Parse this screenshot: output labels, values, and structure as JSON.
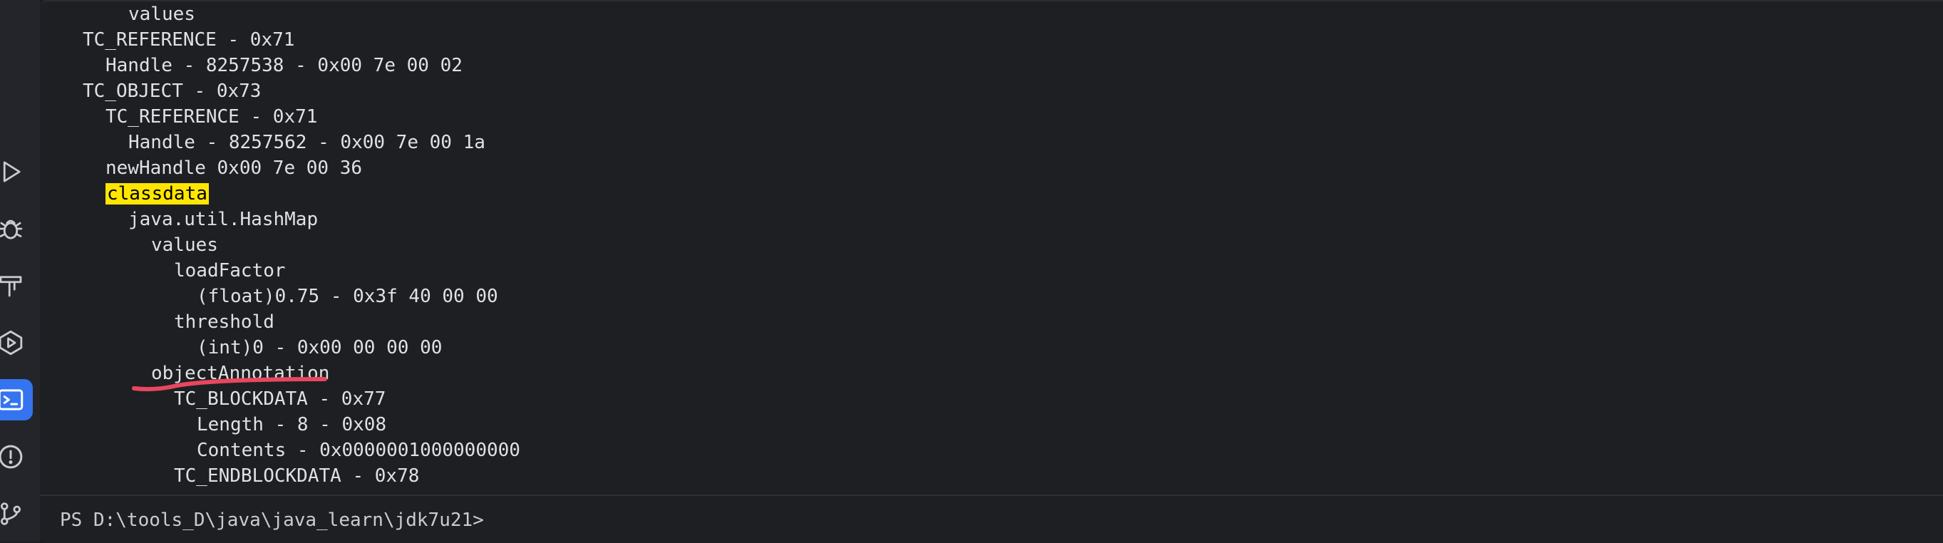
{
  "sidebar": {
    "icons": [
      {
        "name": "run-icon",
        "active": false
      },
      {
        "name": "debug-icon",
        "active": false
      },
      {
        "name": "build-icon",
        "active": false
      },
      {
        "name": "services-icon",
        "active": false
      },
      {
        "name": "terminal-icon",
        "active": true
      },
      {
        "name": "problems-icon",
        "active": false
      },
      {
        "name": "git-icon",
        "active": false
      }
    ]
  },
  "terminal": {
    "lines": [
      {
        "indent": 3,
        "text": "values"
      },
      {
        "indent": 1,
        "text": "TC_REFERENCE - 0x71"
      },
      {
        "indent": 2,
        "text": "Handle - 8257538 - 0x00 7e 00 02"
      },
      {
        "indent": 1,
        "text": "TC_OBJECT - 0x73"
      },
      {
        "indent": 2,
        "text": "TC_REFERENCE - 0x71"
      },
      {
        "indent": 3,
        "text": "Handle - 8257562 - 0x00 7e 00 1a"
      },
      {
        "indent": 2,
        "text": "newHandle 0x00 7e 00 36"
      },
      {
        "indent": 2,
        "text": "classdata",
        "highlight": true
      },
      {
        "indent": 3,
        "text": "java.util.HashMap"
      },
      {
        "indent": 4,
        "text": "values"
      },
      {
        "indent": 5,
        "text": "loadFactor"
      },
      {
        "indent": 6,
        "text": "(float)0.75 - 0x3f 40 00 00"
      },
      {
        "indent": 5,
        "text": "threshold"
      },
      {
        "indent": 6,
        "text": "(int)0 - 0x00 00 00 00"
      },
      {
        "indent": 4,
        "text": "objectAnnotation",
        "underlined": true
      },
      {
        "indent": 5,
        "text": "TC_BLOCKDATA - 0x77"
      },
      {
        "indent": 6,
        "text": "Length - 8 - 0x08"
      },
      {
        "indent": 6,
        "text": "Contents - 0x0000001000000000"
      },
      {
        "indent": 5,
        "text": "TC_ENDBLOCKDATA - 0x78"
      }
    ],
    "prompt": "PS D:\\tools_D\\java\\java_learn\\jdk7u21>"
  },
  "colors": {
    "background": "#1e1f22",
    "text": "#dfe1e5",
    "highlight": "#ffe600",
    "annotation": "#e8475f",
    "active_tool": "#3574f0"
  }
}
